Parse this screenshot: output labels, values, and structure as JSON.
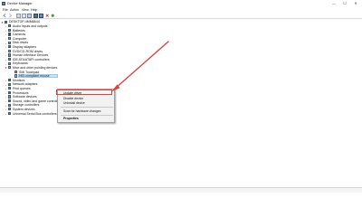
{
  "window": {
    "title": "Device Manager",
    "controls": [
      "—",
      "☐",
      "✕"
    ]
  },
  "menu": [
    "File",
    "Action",
    "View",
    "Help"
  ],
  "toolbar": {
    "buttons": [
      "back-icon",
      "forward-icon",
      "properties-icon",
      "help-icon",
      "show-hidden-icon",
      "monitor-icon",
      "update-driver-icon",
      "uninstall-icon",
      "scan-icon"
    ]
  },
  "tree": {
    "root": "DESKTOP-4MM8A44",
    "categories": [
      "Audio inputs and outputs",
      "Batteries",
      "Cameras",
      "Computer",
      "Disk drives",
      "Display adapters",
      "DVD/CD-ROM drives",
      "Human Interface Devices",
      "IDE ATA/ATAPI controllers",
      "Keyboards",
      "Mice and other pointing devices",
      "Monitors",
      "Network adapters",
      "Print queues",
      "Processors",
      "Software devices",
      "Sound, video and game controllers",
      "Storage controllers",
      "System devices",
      "Universal Serial Bus controllers"
    ],
    "mice_children": [
      "SMI Touchpad",
      "HID-compliant mouse"
    ]
  },
  "context_menu": {
    "items": [
      "Update driver",
      "Disable device",
      "Uninstall device",
      "Scan for hardware changes",
      "Properties"
    ]
  },
  "colors": {
    "annotation": "#d9443d",
    "selection": "#cce4f7"
  }
}
